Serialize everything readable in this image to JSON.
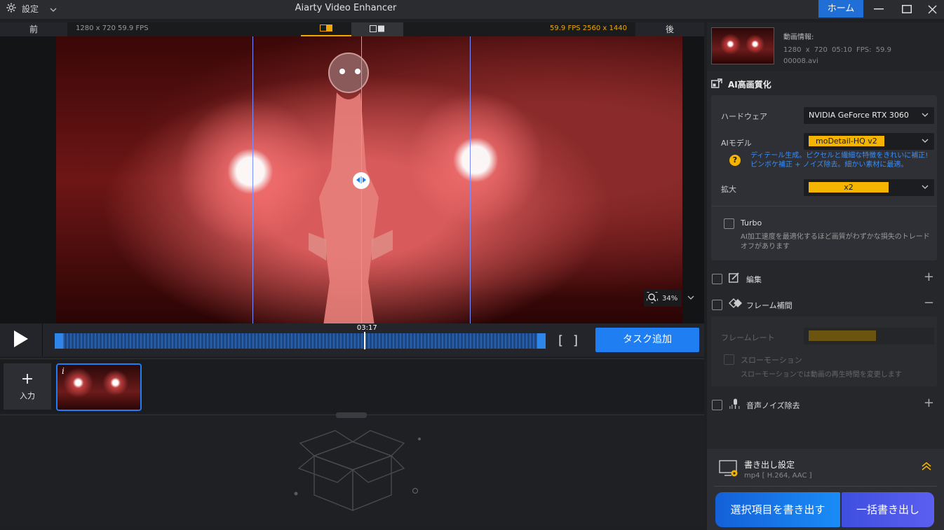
{
  "titlebar": {
    "settings_label": "設定",
    "app_title": "Aiarty Video Enhancer",
    "home_label": "ホーム"
  },
  "preview": {
    "before_label": "前",
    "after_label": "後",
    "source_info": "1280 x 720  59.9 FPS",
    "output_info": "59.9 FPS  2560 x 1440",
    "zoom_level": "34%"
  },
  "timeline": {
    "current_time": "03:17",
    "playhead_progress": 0.632,
    "task_button": "タスク追加"
  },
  "input": {
    "add_label": "入力",
    "info_icon_label": "i"
  },
  "video_info": {
    "title": "動画情報:",
    "details": "1280 x 720  05:10    FPS: 59.9",
    "filename": "00008.avi"
  },
  "ai_enhance": {
    "title": "AI高画質化",
    "hardware_label": "ハードウェア",
    "hardware_value": "NVIDIA GeForce RTX 3060",
    "model_label": "AIモデル",
    "model_value": "moDetail-HQ  v2",
    "model_desc": "ディテール生成。ピクセルと繊細な特徴をきれいに補正! ピンボケ補正 + ノイズ除去。細かい素材に最適。",
    "upscale_label": "拡大",
    "upscale_value": "x2",
    "turbo_label": "Turbo",
    "turbo_desc": "AI加工速度を最適化するほど画質がわずかな損失のトレードオフがあります"
  },
  "features": {
    "edit_label": "編集",
    "frame_interp_label": "フレーム補間",
    "framerate_label": "フレームレート",
    "slowmo_label": "スローモーション",
    "slowmo_desc": "スローモーションでは動画の再生時間を変更します",
    "audio_denoise_label": "音声ノイズ除去"
  },
  "export": {
    "title": "書き出し設定",
    "format": "mp4 [ H.264, AAC ]",
    "export_selected": "選択項目を書き出す",
    "export_all": "一括書き出し"
  },
  "colors": {
    "accent_blue": "#1f7ef2",
    "accent_yellow": "#f4b400",
    "panel_bg": "#26272b"
  }
}
